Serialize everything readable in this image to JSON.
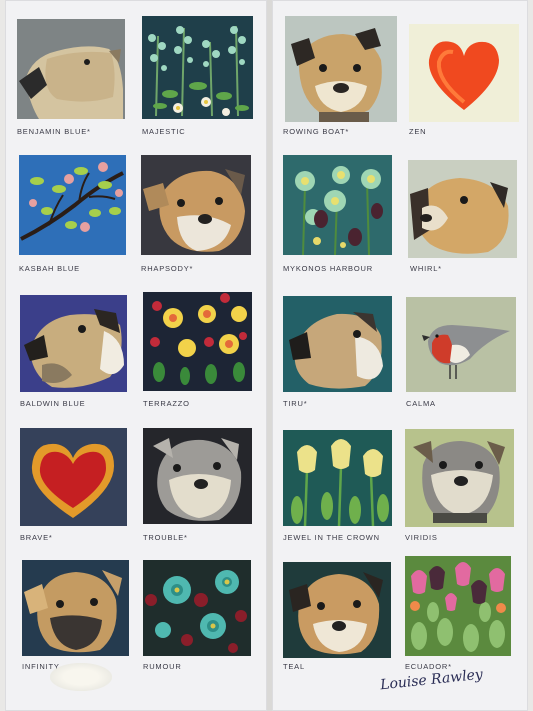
{
  "swatches": [
    {
      "id": "benjamin-blue",
      "label": "BENJAMIN BLUE*",
      "bg": "#7e8485",
      "subject": "dog"
    },
    {
      "id": "majestic",
      "label": "MAJESTIC",
      "bg": "#1f3f4a",
      "subject": "flowers"
    },
    {
      "id": "rowing-boat",
      "label": "ROWING BOAT*",
      "bg": "#bcc6c0",
      "subject": "dog"
    },
    {
      "id": "zen",
      "label": "ZEN",
      "bg": "#f0efd8",
      "subject": "heart"
    },
    {
      "id": "kasbah-blue",
      "label": "KASBAH BLUE",
      "bg": "#2e6fb8",
      "subject": "branch"
    },
    {
      "id": "rhapsody",
      "label": "RHAPSODY*",
      "bg": "#38383f",
      "subject": "dog"
    },
    {
      "id": "mykonos-harbour",
      "label": "MYKONOS HARBOUR",
      "bg": "#2e6a6c",
      "subject": "flowers"
    },
    {
      "id": "whirl",
      "label": "WHIRL*",
      "bg": "#c9cfc1",
      "subject": "dog"
    },
    {
      "id": "baldwin-blue",
      "label": "BALDWIN BLUE",
      "bg": "#3b3f8a",
      "subject": "dog"
    },
    {
      "id": "terrazzo",
      "label": "TERRAZZO",
      "bg": "#1d2535",
      "subject": "flowers"
    },
    {
      "id": "tiru",
      "label": "TIRU*",
      "bg": "#236067",
      "subject": "dog"
    },
    {
      "id": "calma",
      "label": "CALMA",
      "bg": "#b9c1a4",
      "subject": "bird"
    },
    {
      "id": "brave",
      "label": "BRAVE*",
      "bg": "#35415a",
      "subject": "heart"
    },
    {
      "id": "trouble",
      "label": "TROUBLE*",
      "bg": "#25262b",
      "subject": "dog"
    },
    {
      "id": "jewel-in-the-crown",
      "label": "JEWEL IN THE CROWN",
      "bg": "#1f5a56",
      "subject": "tulips"
    },
    {
      "id": "viridis",
      "label": "VIRIDIS",
      "bg": "#b7c28c",
      "subject": "dog"
    },
    {
      "id": "infinity",
      "label": "INFINITY",
      "bg": "#253b4f",
      "subject": "dog"
    },
    {
      "id": "rumour",
      "label": "RUMOUR",
      "bg": "#1f2d2c",
      "subject": "flowers"
    },
    {
      "id": "teal",
      "label": "TEAL",
      "bg": "#1f3b3b",
      "subject": "dog"
    },
    {
      "id": "ecuador",
      "label": "ECUADOR*",
      "bg": "#5b8a3e",
      "subject": "tulips"
    }
  ],
  "signature": "Louise Rawley"
}
